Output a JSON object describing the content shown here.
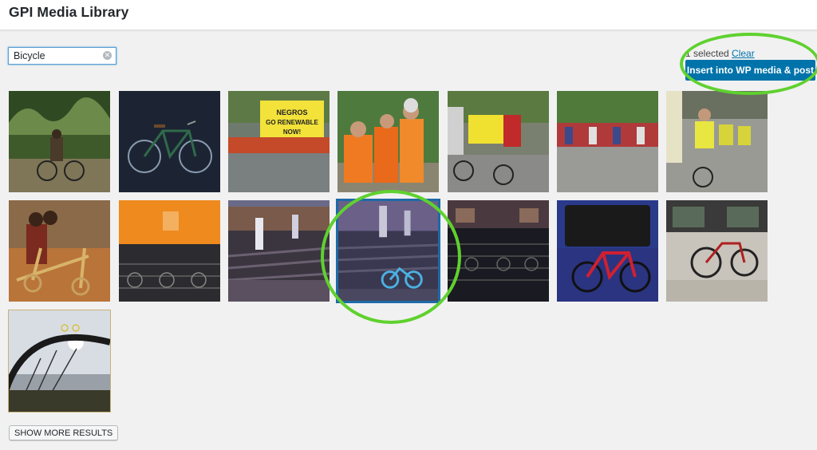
{
  "header": {
    "title": "GPI Media Library"
  },
  "search": {
    "value": "Bicycle",
    "clear_icon": "clear-search-icon"
  },
  "selection": {
    "count_text": "1 selected",
    "clear_label": "Clear",
    "insert_label": "Insert into WP media & post"
  },
  "thumbnails": [
    {
      "name": "thumb-1",
      "subject": "child on bicycle in forest"
    },
    {
      "name": "thumb-2",
      "subject": "green bicycle on dark background"
    },
    {
      "name": "thumb-3",
      "subject": "cyclists with Negros Go Renewable banner"
    },
    {
      "name": "thumb-4",
      "subject": "cyclists in orange shirts"
    },
    {
      "name": "thumb-5",
      "subject": "cyclists with yellow banner"
    },
    {
      "name": "thumb-6",
      "subject": "crowd of cyclists on street"
    },
    {
      "name": "thumb-7",
      "subject": "cyclists in yellow shirts"
    },
    {
      "name": "thumb-8",
      "subject": "child on wooden bicycle"
    },
    {
      "name": "thumb-9",
      "subject": "bicycle parking under orange light"
    },
    {
      "name": "thumb-10",
      "subject": "bicycle parking plaza at dusk"
    },
    {
      "name": "thumb-11",
      "subject": "parked bicycles with blue bike",
      "selected": true
    },
    {
      "name": "thumb-12",
      "subject": "bicycle parking at night"
    },
    {
      "name": "thumb-13",
      "subject": "red bicycle in train"
    },
    {
      "name": "thumb-14",
      "subject": "bicycles in train car"
    },
    {
      "name": "thumb-15",
      "subject": "bicycle wheel and sky"
    }
  ],
  "show_more_label": "SHOW MORE RESULTS",
  "colors": {
    "accent": "#0073aa",
    "highlight_circle": "#5fd12f",
    "selected_border": "#1e6aa8"
  }
}
